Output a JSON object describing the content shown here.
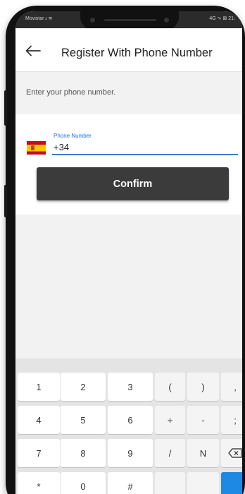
{
  "status_bar": {
    "carrier": "Movistar ᵢₗ ≋",
    "right": "4G ∿ ⊠ 21:"
  },
  "app_bar": {
    "title": "Register With Phone Number",
    "back_icon": "arrow-left-icon"
  },
  "hint": {
    "text": "Enter your phone number."
  },
  "form": {
    "country_flag": "spain-flag-icon",
    "phone_label": "Phone Number",
    "phone_value": "+34",
    "confirm_label": "Confirm"
  },
  "keyboard": {
    "row1": [
      "1",
      "2",
      "3",
      "(",
      ")",
      ","
    ],
    "row2": [
      "4",
      "5",
      "6",
      "+",
      "-",
      ";"
    ],
    "row3": [
      "7",
      "8",
      "9",
      "/",
      "N",
      ""
    ],
    "row4": [
      "*",
      "0",
      "#",
      "",
      "",
      ""
    ],
    "backspace_icon": "backspace-icon",
    "accent_color": "#1e88e5"
  },
  "colors": {
    "confirm_button": "#3b3b3b",
    "input_underline": "#3a7bd5",
    "label": "#1a73e8"
  }
}
